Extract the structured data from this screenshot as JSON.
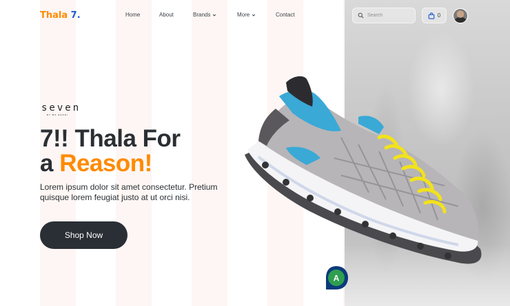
{
  "brand": {
    "name": "Thala",
    "suffix": "7."
  },
  "nav": {
    "items": [
      {
        "label": "Home",
        "has_menu": false
      },
      {
        "label": "About",
        "has_menu": false
      },
      {
        "label": "Brands",
        "has_menu": true
      },
      {
        "label": "More",
        "has_menu": true
      },
      {
        "label": "Contact",
        "has_menu": false
      }
    ]
  },
  "search": {
    "placeholder": "Search",
    "icon": "search-icon"
  },
  "cart": {
    "count": "0",
    "icon": "shopping-bag-icon"
  },
  "hero": {
    "brand_mark": "seven",
    "brand_mark_sub": "BY MS DHONI",
    "headline_line1": "7!! Thala For",
    "headline_prefix": "a ",
    "headline_accent": "Reason!",
    "description": "Lorem ipsum dolor sit amet consectetur. Pretium quisque lorem feugiat justo at ut orci nisi.",
    "cta_label": "Shop Now"
  },
  "floating_badge": {
    "letter": "A"
  },
  "colors": {
    "accent": "#ff8a00",
    "logo_number": "#1e5ad7",
    "button_bg": "#2a2f35",
    "shoe_blue": "#3aa9d6",
    "shoe_laces": "#f2e21c",
    "badge_green": "#2e9e4f",
    "badge_ring": "#0b3b7a"
  }
}
